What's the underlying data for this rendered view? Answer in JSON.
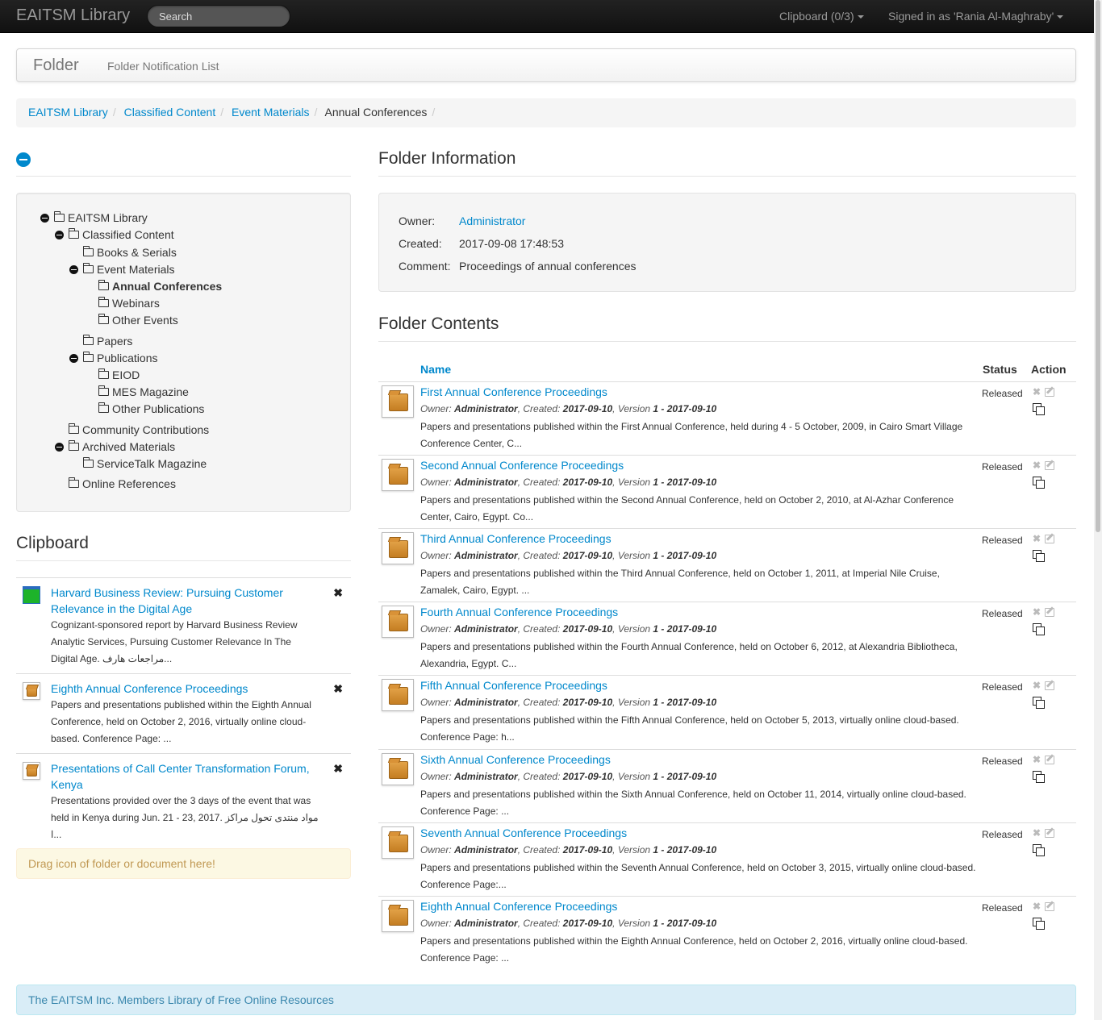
{
  "navbar": {
    "brand": "EAITSM Library",
    "search_placeholder": "Search",
    "clipboard": "Clipboard (0/3)",
    "signed_in": "Signed in as 'Rania Al-Maghraby'"
  },
  "header": {
    "title": "Folder",
    "link": "Folder Notification List"
  },
  "breadcrumb": [
    "EAITSM Library",
    "Classified Content",
    "Event Materials",
    "Annual Conferences"
  ],
  "tree": [
    {
      "label": "EAITSM Library",
      "expanded": true
    },
    {
      "label": "Classified Content",
      "expanded": true
    },
    {
      "label": "Books & Serials"
    },
    {
      "label": "Event Materials",
      "expanded": true
    },
    {
      "label": "Annual Conferences",
      "selected": true
    },
    {
      "label": "Webinars"
    },
    {
      "label": "Other Events"
    },
    {
      "label": "Papers"
    },
    {
      "label": "Publications",
      "expanded": true
    },
    {
      "label": "EIOD"
    },
    {
      "label": "MES Magazine"
    },
    {
      "label": "Other Publications"
    },
    {
      "label": "Community Contributions"
    },
    {
      "label": "Archived Materials",
      "expanded": true
    },
    {
      "label": "ServiceTalk Magazine"
    },
    {
      "label": "Online References"
    }
  ],
  "clipboard": {
    "heading": "Clipboard",
    "items": [
      {
        "title_lines": [
          "Harvard Business Review: Pursuing Customer",
          "Relevance in the Digital Age"
        ],
        "desc_lines": [
          "Cognizant-sponsored report by Harvard Business Review",
          "Analytic Services, Pursuing Customer Relevance In The",
          "Digital Age. مراجعات هارف..."
        ]
      },
      {
        "title_lines": [
          "Eighth Annual Conference Proceedings"
        ],
        "desc_lines": [
          "Papers and presentations published within the Eighth Annual",
          "Conference, held on October 2, 2016, virtually online cloud-",
          "based. Conference Page: ..."
        ]
      },
      {
        "title_lines": [
          "Presentations of Call Center Transformation Forum,",
          "Kenya"
        ],
        "desc_lines": [
          "Presentations provided over the 3 days of the event that was",
          "held in Kenya during Jun. 21 - 23, 2017. مواد منتدى تحول مراكز ا..."
        ]
      }
    ],
    "drop_hint": "Drag icon of folder or document here!"
  },
  "folder_info": {
    "heading": "Folder Information",
    "owner_label": "Owner:",
    "owner": "Administrator",
    "created_label": "Created:",
    "created": "2017-09-08 17:48:53",
    "comment_label": "Comment:",
    "comment": "Proceedings of annual conferences"
  },
  "folder_contents": {
    "heading": "Folder Contents",
    "columns": {
      "name": "Name",
      "status": "Status",
      "action": "Action"
    },
    "meta_labels": {
      "owner": "Owner:",
      "created": "Created:",
      "version": "Version"
    },
    "rows": [
      {
        "title": "First Annual Conference Proceedings",
        "owner": "Administrator",
        "created": "2017-09-10",
        "version": "1 - 2017-09-10",
        "status": "Released",
        "desc_lines": [
          "Papers and presentations published within the First Annual Conference, held during 4 - 5 October, 2009, in Cairo Smart Village",
          "Conference Center, C..."
        ]
      },
      {
        "title": "Second Annual Conference Proceedings",
        "owner": "Administrator",
        "created": "2017-09-10",
        "version": "1 - 2017-09-10",
        "status": "Released",
        "desc_lines": [
          "Papers and presentations published within the Second Annual Conference, held on October 2, 2010, at Al-Azhar Conference",
          "Center, Cairo, Egypt. Co..."
        ]
      },
      {
        "title": "Third Annual Conference Proceedings",
        "owner": "Administrator",
        "created": "2017-09-10",
        "version": "1 - 2017-09-10",
        "status": "Released",
        "desc_lines": [
          "Papers and presentations published within the Third Annual Conference, held on October 1, 2011, at Imperial Nile Cruise,",
          "Zamalek, Cairo, Egypt. ..."
        ]
      },
      {
        "title": "Fourth Annual Conference Proceedings",
        "owner": "Administrator",
        "created": "2017-09-10",
        "version": "1 - 2017-09-10",
        "status": "Released",
        "desc_lines": [
          "Papers and presentations published within the Fourth Annual Conference, held on October 6, 2012, at Alexandria Bibliotheca,",
          "Alexandria, Egypt. C..."
        ]
      },
      {
        "title": "Fifth Annual Conference Proceedings",
        "owner": "Administrator",
        "created": "2017-09-10",
        "version": "1 - 2017-09-10",
        "status": "Released",
        "desc_lines": [
          "Papers and presentations published within the Fifth Annual Conference, held on October 5, 2013, virtually online cloud-based.",
          "Conference Page: h..."
        ]
      },
      {
        "title": "Sixth Annual Conference Proceedings",
        "owner": "Administrator",
        "created": "2017-09-10",
        "version": "1 - 2017-09-10",
        "status": "Released",
        "desc_lines": [
          "Papers and presentations published within the Sixth Annual Conference, held on October 11, 2014, virtually online cloud-based.",
          "Conference Page: ..."
        ]
      },
      {
        "title": "Seventh Annual Conference Proceedings",
        "owner": "Administrator",
        "created": "2017-09-10",
        "version": "1 - 2017-09-10",
        "status": "Released",
        "desc_lines": [
          "Papers and presentations published within the Seventh Annual Conference, held on October 3, 2015, virtually online cloud-based.",
          "Conference Page:..."
        ]
      },
      {
        "title": "Eighth Annual Conference Proceedings",
        "owner": "Administrator",
        "created": "2017-09-10",
        "version": "1 - 2017-09-10",
        "status": "Released",
        "desc_lines": [
          "Papers and presentations published within the Eighth Annual Conference, held on October 2, 2016, virtually online cloud-based.",
          "Conference Page: ..."
        ]
      }
    ]
  },
  "footer": "The EAITSM Inc. Members Library of Free Online Resources"
}
